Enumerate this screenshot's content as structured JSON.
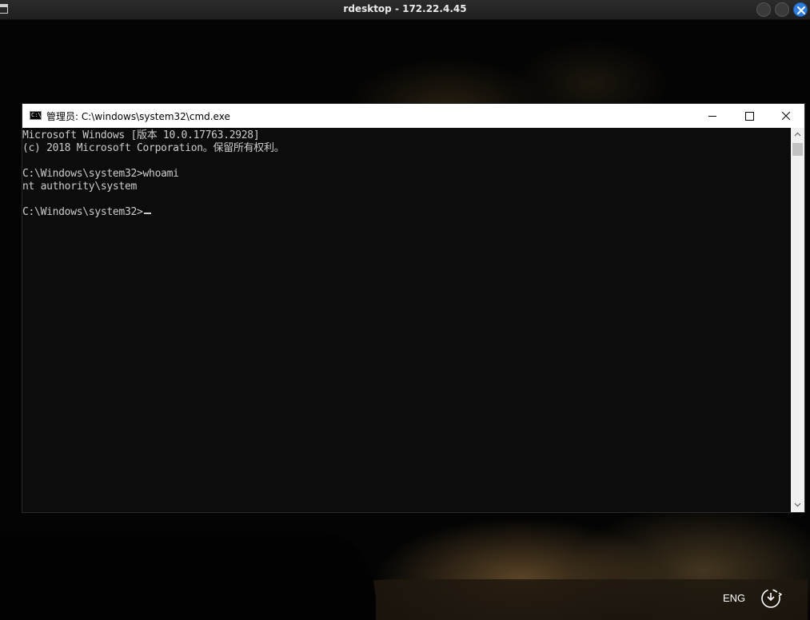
{
  "host_window": {
    "title": "rdesktop - 172.22.4.45",
    "close_color": "#2f7ddf"
  },
  "cmd_window": {
    "title": "管理员: C:\\windows\\system32\\cmd.exe",
    "icon_text": "C:\\",
    "console_lines": [
      "Microsoft Windows [版本 10.0.17763.2928]",
      "(c) 2018 Microsoft Corporation。保留所有权利。",
      "C:\\Windows\\system32>whoami",
      "nt authority\\system",
      "C:\\Windows\\system32>"
    ]
  },
  "taskbar": {
    "language": "ENG",
    "tray_icon": "clock-download-icon"
  }
}
